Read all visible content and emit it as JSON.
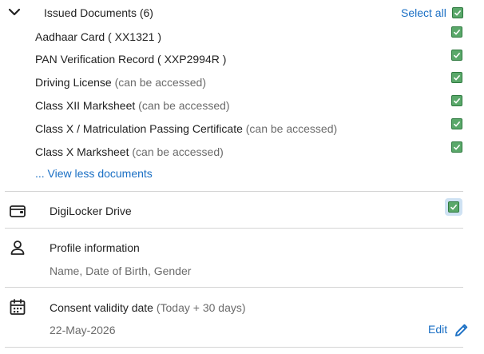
{
  "issued": {
    "title": "Issued Documents (6)",
    "select_all": "Select all",
    "documents": [
      {
        "name": "Aadhaar Card ( XX1321 )",
        "hint": ""
      },
      {
        "name": "PAN Verification Record ( XXP2994R )",
        "hint": ""
      },
      {
        "name": "Driving License",
        "hint": "(can be accessed)"
      },
      {
        "name": "Class XII Marksheet",
        "hint": "(can be accessed)"
      },
      {
        "name": "Class X / Matriculation Passing Certificate",
        "hint": "(can be accessed)"
      },
      {
        "name": "Class X Marksheet",
        "hint": "(can be accessed)"
      }
    ],
    "view_less": "... View less documents"
  },
  "drive": {
    "title": "DigiLocker Drive",
    "checked": true
  },
  "profile": {
    "title": "Profile information",
    "subtitle": "Name, Date of Birth, Gender"
  },
  "consent": {
    "title": "Consent validity date",
    "hint": "(Today + 30 days)",
    "date": "22-May-2026",
    "edit_label": "Edit"
  },
  "colors": {
    "accent": "#1a6fc4",
    "checkbox": "#5aa86a"
  },
  "icons": [
    "chevron-down-icon",
    "wallet-icon",
    "person-icon",
    "calendar-icon",
    "pencil-icon",
    "check-icon"
  ]
}
